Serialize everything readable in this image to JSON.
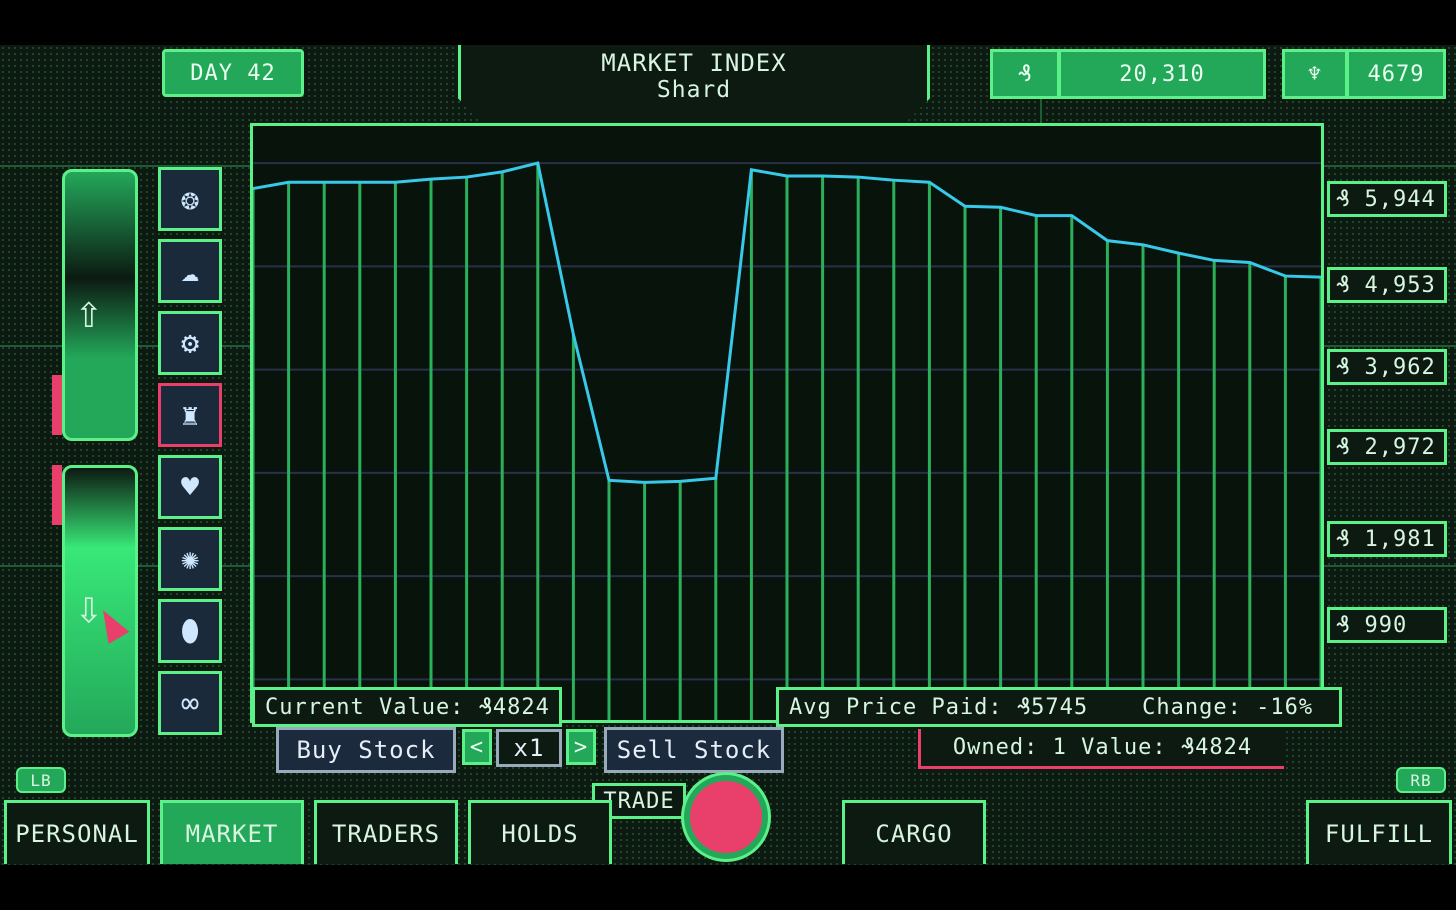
{
  "header": {
    "day": "DAY 42",
    "title_line1": "MARKET INDEX",
    "title_line2": "Shard",
    "currency_icon": "shard-currency-icon",
    "balance": "20,310",
    "trophy_icon": "trophy-icon",
    "score": "4679"
  },
  "chart_data": {
    "type": "line",
    "y_ticks": [
      "5,944",
      "4,953",
      "3,962",
      "2,972",
      "1,981",
      "990"
    ],
    "currency_symbol": "₰",
    "values": [
      5700,
      5760,
      5760,
      5760,
      5760,
      5790,
      5810,
      5860,
      5944,
      4300,
      2900,
      2880,
      2890,
      2920,
      5880,
      5820,
      5820,
      5810,
      5780,
      5760,
      5530,
      5520,
      5440,
      5440,
      5200,
      5160,
      5080,
      5010,
      4990,
      4860,
      4850
    ],
    "ylim": [
      600,
      6300
    ],
    "line_color": "#38c8e8",
    "grid": true
  },
  "info": {
    "current_value": "Current Value: ₰4824",
    "avg_price": "Avg Price Paid: ₰5745",
    "change": "Change: -16%",
    "owned": "Owned: 1 Value: ₰4824"
  },
  "trade": {
    "buy": "Buy Stock",
    "sell": "Sell Stock",
    "quantity": "x1",
    "trade_label": "TRADE",
    "prev": "<",
    "next": ">"
  },
  "shoulders": {
    "left": "LB",
    "right": "RB"
  },
  "tabs": [
    "PERSONAL",
    "MARKET",
    "TRADERS",
    "HOLDS",
    "CARGO",
    "FULFILL"
  ],
  "commodities": [
    "shell-icon",
    "cloud-icon",
    "gear-icon",
    "lantern-icon",
    "heart-icon",
    "orb-icon",
    "egg-icon",
    "chain-icon"
  ],
  "colors": {
    "accent": "#5cf089",
    "panel": "#23a85a",
    "line": "#38c8e8",
    "alert": "#e8406a"
  }
}
